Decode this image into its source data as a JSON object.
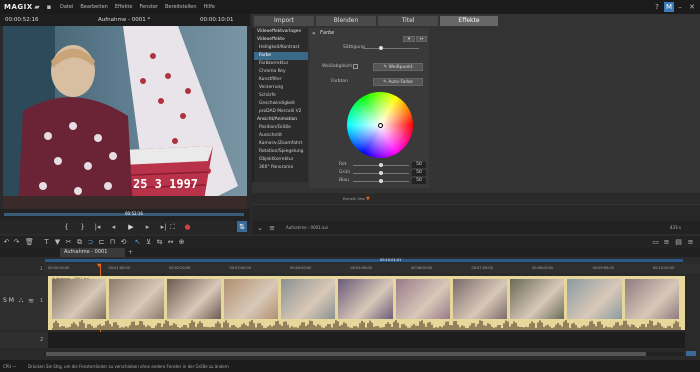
{
  "app": {
    "logo": "MAGIX",
    "menu": [
      "Datei",
      "Bearbeiten",
      "Effekte",
      "Fenster",
      "Bereitstellen",
      "Hilfe"
    ]
  },
  "preview": {
    "time_left": "00:00:52:16",
    "title": "Aufnahme - 0001 *",
    "time_right": "00:00:10:01",
    "date_overlay": "25 3 1997",
    "scrub_time": "00:52:16"
  },
  "tabs": [
    "Import",
    "Blenden",
    "Titel",
    "Effekte"
  ],
  "effects_section": "Farbe",
  "effects": [
    {
      "label": "Videoeffektvorlagen",
      "kind": "cat"
    },
    {
      "label": "Videoeffekte",
      "kind": "cat"
    },
    {
      "label": "Helligkeit/Kontrast",
      "kind": "sub"
    },
    {
      "label": "Farbe",
      "kind": "sub",
      "selected": true
    },
    {
      "label": "Farbkorrektur",
      "kind": "sub"
    },
    {
      "label": "Chroma Key",
      "kind": "sub"
    },
    {
      "label": "Kunstfilter",
      "kind": "sub"
    },
    {
      "label": "Verzerrung",
      "kind": "sub"
    },
    {
      "label": "Schärfe",
      "kind": "sub"
    },
    {
      "label": "Geschwindigkeit",
      "kind": "sub"
    },
    {
      "label": "proDAD Mercalli V2",
      "kind": "sub"
    },
    {
      "label": "Ansicht/Animation",
      "kind": "cat"
    },
    {
      "label": "Position/Größe",
      "kind": "sub"
    },
    {
      "label": "Ausschnitt",
      "kind": "sub"
    },
    {
      "label": "Kamera-/Zoomfahrt",
      "kind": "sub"
    },
    {
      "label": "Rotation/Spiegelung",
      "kind": "sub"
    },
    {
      "label": "Objektkorrektur",
      "kind": "sub"
    },
    {
      "label": "360° Panorama",
      "kind": "sub"
    }
  ],
  "color_panel": {
    "saturation_label": "Sättigung",
    "wb_label": "Weißabgleich",
    "wb_button": "Weißpunkt",
    "hue_label": "Farbton",
    "auto_button": "Auto-Farbe",
    "sliders": [
      {
        "label": "Rot",
        "value": "50"
      },
      {
        "label": "Grün",
        "value": "50"
      },
      {
        "label": "Blau",
        "value": "50"
      }
    ]
  },
  "preview_strip": {
    "label": "Einheit: 0ms",
    "clip_name": "Aufnahme - 0001.avi",
    "zoom": "433 s"
  },
  "timeline": {
    "tab_label": "Aufnahme - 0001",
    "ruler": [
      "00:00:00:00",
      "00:01:00:00",
      "00:02:00:00",
      "00:03:00:00",
      "00:04:00:00",
      "00:05:00:00",
      "00:06:00:00",
      "00:07:00:00",
      "00:08:00:00",
      "00:09:00:00",
      "00:10:00:00"
    ],
    "center_time": "00:10:01:01",
    "clip_label": "Aufnahme - 0001.avi",
    "track_nums": [
      "1",
      "2"
    ],
    "track_flags": "S M",
    "cursor_time": "00:10:01:01",
    "clips": [
      {
        "color": "#7a6a5a"
      },
      {
        "color": "#8a7a6a"
      },
      {
        "color": "#6a5a50"
      },
      {
        "color": "#b09070"
      },
      {
        "color": "#8a9090"
      },
      {
        "color": "#6a5a7a"
      },
      {
        "color": "#9a7a8a"
      },
      {
        "color": "#7a6a6a"
      },
      {
        "color": "#6a6a58"
      },
      {
        "color": "#8a9aa0"
      },
      {
        "color": "#907a80"
      }
    ]
  },
  "status": {
    "cpu": "CPU —",
    "hint": "Drücken Sie Strg, um die Fensterränder zu verschieben ohne andere Fenster in der Größe zu ändern"
  }
}
